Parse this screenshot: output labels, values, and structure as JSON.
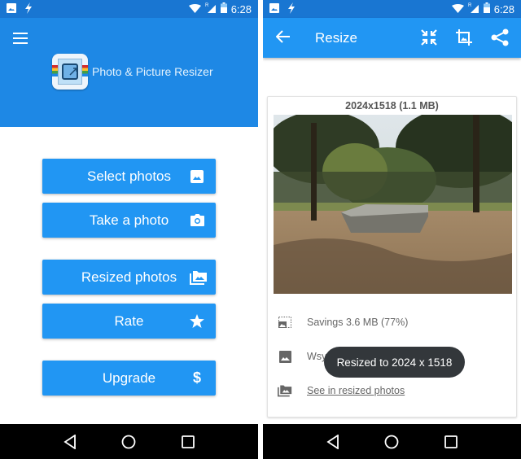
{
  "status_bar": {
    "time": "6:28",
    "left_icons": [
      "image-notification-icon",
      "flash-icon"
    ],
    "right_icons": [
      "wifi-icon",
      "cellular-roaming-icon",
      "battery-icon"
    ],
    "roaming_label": "R"
  },
  "left_screen": {
    "app_title": "Photo & Picture Resizer",
    "menu_icon": "hamburger-menu-icon",
    "buttons": [
      {
        "label": "Select photos",
        "icon": "image-icon"
      },
      {
        "label": "Take a photo",
        "icon": "camera-icon"
      },
      {
        "label": "Resized photos",
        "icon": "photo-library-icon"
      },
      {
        "label": "Rate",
        "icon": "star-icon"
      },
      {
        "label": "Upgrade",
        "icon": "dollar-icon"
      }
    ]
  },
  "right_screen": {
    "toolbar": {
      "title": "Resize",
      "back_icon": "arrow-back-icon",
      "actions": [
        "compress-icon",
        "crop-icon",
        "share-icon"
      ]
    },
    "card": {
      "dimensions": "2024x1518 (1.1 MB)",
      "photo_description": "Park scene with a large flat stone slab under trees",
      "savings": "Savings 3.6 MB (77%)",
      "filename_visible": "Wsy",
      "see_link": "See in resized photos"
    },
    "toast": "Resized to 2024 x 1518"
  },
  "nav_bar": {
    "buttons": [
      "back-icon",
      "home-icon",
      "recents-icon"
    ]
  },
  "colors": {
    "status_bar": "#1976d2",
    "header": "#1e88e5",
    "button": "#2196f3",
    "toast": "#33373b"
  }
}
